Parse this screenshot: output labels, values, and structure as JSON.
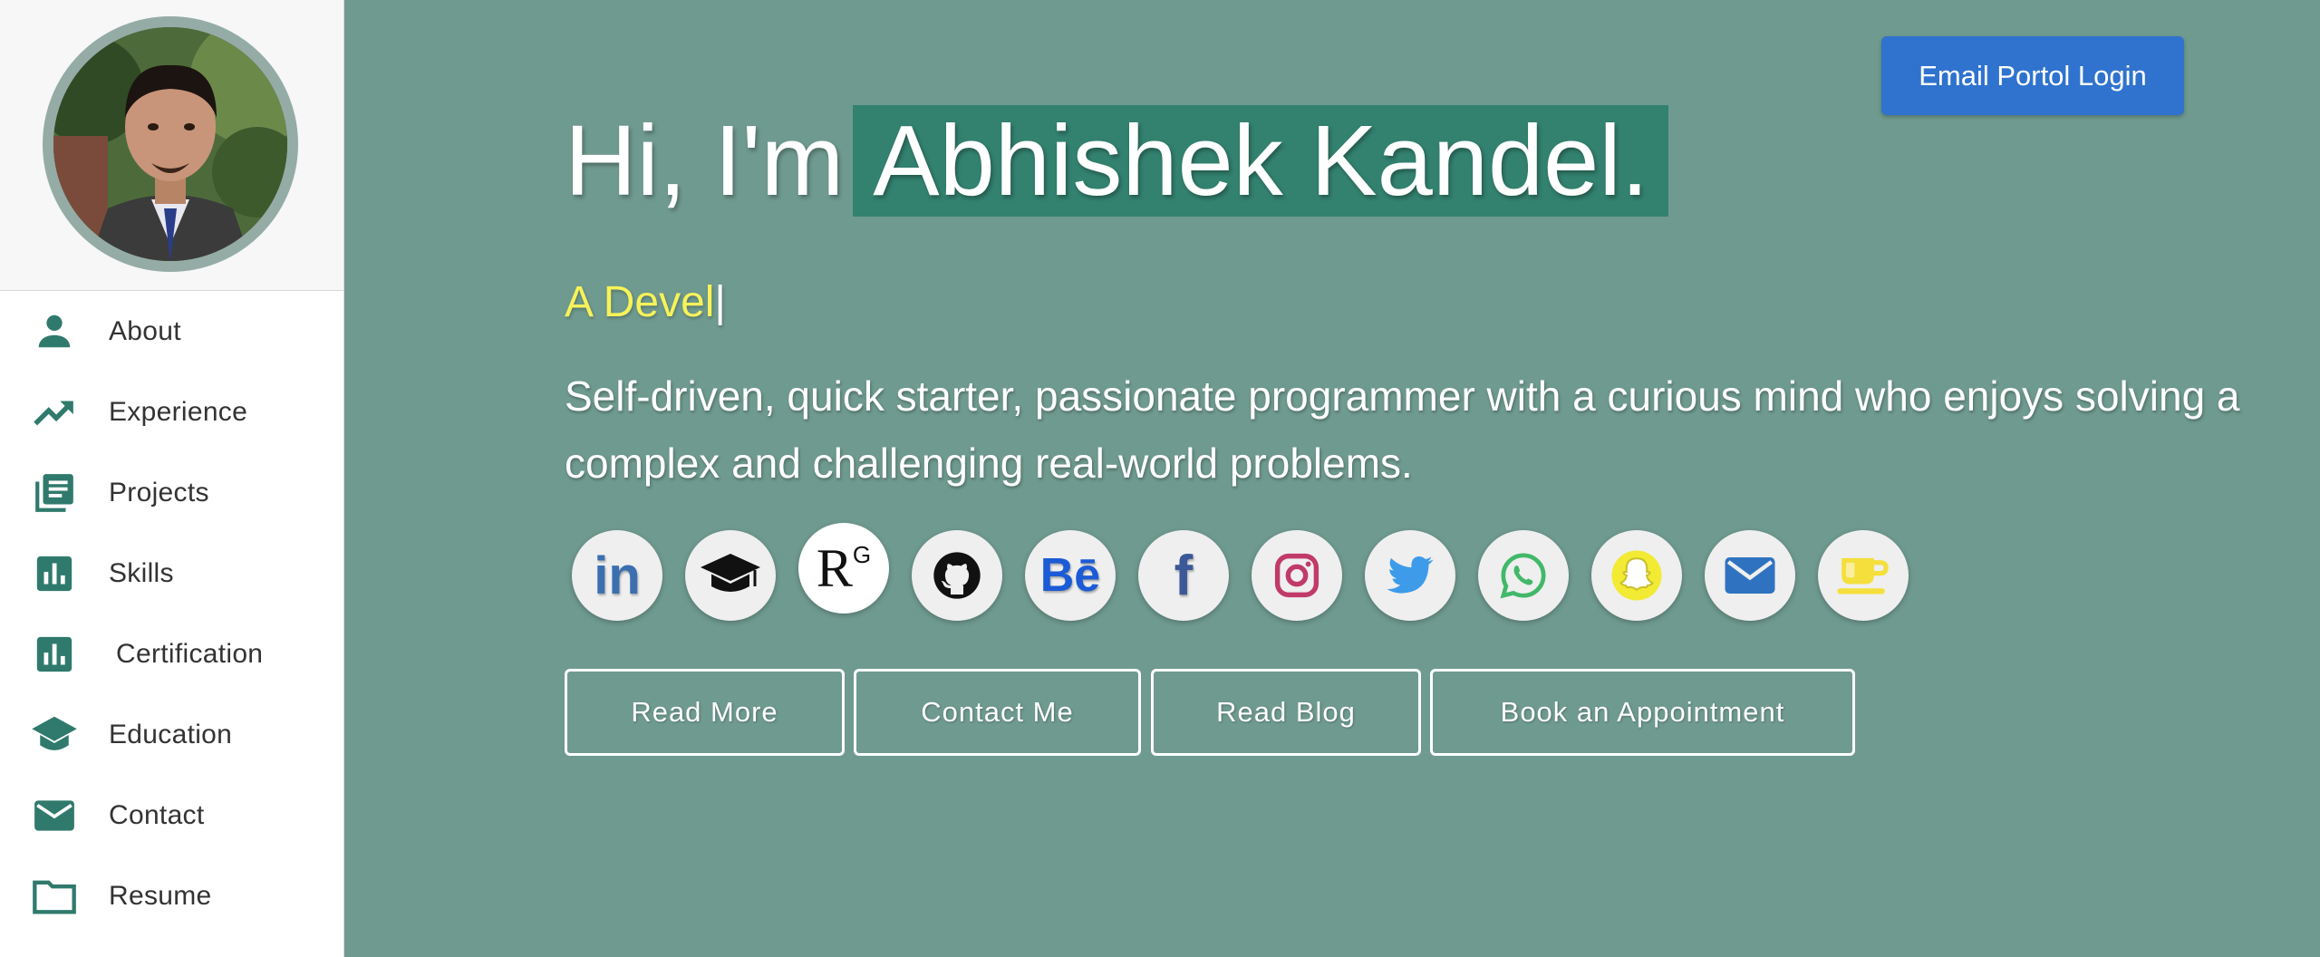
{
  "sidebar": {
    "avatar_icon": "profile-photo",
    "items": [
      {
        "label": "About",
        "icon": "person-icon"
      },
      {
        "label": "Experience",
        "icon": "trending-up-icon"
      },
      {
        "label": "Projects",
        "icon": "library-books-icon"
      },
      {
        "label": "Skills",
        "icon": "bar-chart-icon"
      },
      {
        "label": "Certification",
        "icon": "bar-chart-icon"
      },
      {
        "label": "Education",
        "icon": "graduation-cap-icon"
      },
      {
        "label": "Contact",
        "icon": "mail-icon"
      },
      {
        "label": "Resume",
        "icon": "folder-icon"
      }
    ]
  },
  "header": {
    "login_label": "Email Portol Login"
  },
  "hero": {
    "greeting": "Hi, I'm",
    "name": "Abhishek Kandel.",
    "typed": "A Devel",
    "cursor": "|",
    "tagline": "Self-driven, quick starter, passionate programmer with a curious mind who enjoys solving a complex and challenging real-world problems."
  },
  "socials": [
    {
      "icon": "linkedin-icon",
      "text": "in"
    },
    {
      "icon": "graduation-cap-icon"
    },
    {
      "icon": "researchgate-icon",
      "text": "R",
      "sup": "G"
    },
    {
      "icon": "github-icon"
    },
    {
      "icon": "behance-icon",
      "text": "Bē"
    },
    {
      "icon": "facebook-icon",
      "text": "f"
    },
    {
      "icon": "instagram-icon"
    },
    {
      "icon": "twitter-icon"
    },
    {
      "icon": "whatsapp-icon"
    },
    {
      "icon": "snapchat-icon"
    },
    {
      "icon": "email-icon"
    },
    {
      "icon": "coffee-cup-icon"
    }
  ],
  "actions": {
    "read_more": "Read More",
    "contact_me": "Contact Me",
    "read_blog": "Read Blog",
    "book_appointment": "Book an Appointment"
  },
  "colors": {
    "background": "#6f9a8f",
    "accent": "#33816f",
    "typed_text": "#f6f25a",
    "login_button": "#2f73cf",
    "sidebar_icon": "#2f7a6c"
  }
}
